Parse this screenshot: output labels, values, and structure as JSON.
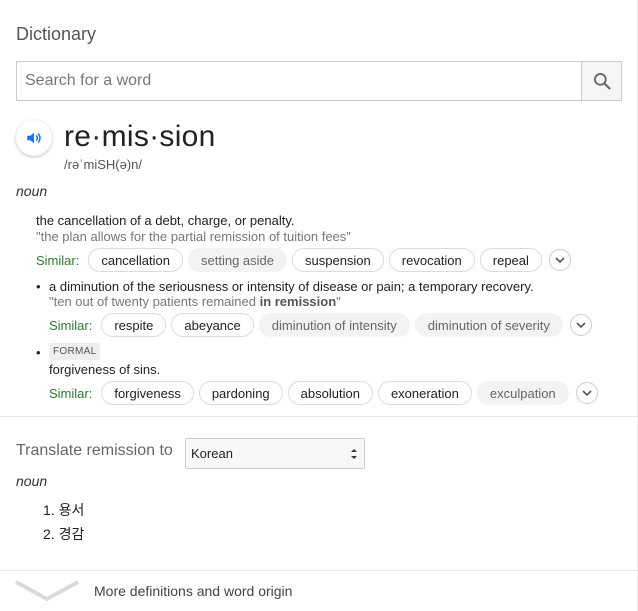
{
  "header": {
    "title": "Dictionary"
  },
  "search": {
    "placeholder": "Search for a word"
  },
  "entry": {
    "word": "re·mis·sion",
    "phonetic": "/rəˈmiSH(ə)n/",
    "part_of_speech": "noun",
    "senses": [
      {
        "definition": "the cancellation of a debt, charge, or penalty.",
        "example": "\"the plan allows for the partial remission of tuition fees\"",
        "similar_label": "Similar:",
        "similar": [
          "cancellation",
          "setting aside",
          "suspension",
          "revocation",
          "repeal"
        ],
        "similar_grey": [
          false,
          true,
          false,
          false,
          false
        ]
      },
      {
        "definition": "a diminution of the seriousness or intensity of disease or pain; a temporary recovery.",
        "example_pre": "\"ten out of twenty patients remained ",
        "example_bold": "in remission",
        "example_post": "\"",
        "similar_label": "Similar:",
        "similar": [
          "respite",
          "abeyance",
          "diminution of intensity",
          "diminution of severity"
        ],
        "similar_grey": [
          false,
          false,
          true,
          true
        ]
      },
      {
        "tag": "FORMAL",
        "definition": "forgiveness of sins.",
        "similar_label": "Similar:",
        "similar": [
          "forgiveness",
          "pardoning",
          "absolution",
          "exoneration",
          "exculpation"
        ],
        "similar_grey": [
          false,
          false,
          false,
          false,
          true
        ]
      }
    ]
  },
  "translate": {
    "label": "Translate remission to",
    "language": "Korean",
    "part_of_speech": "noun",
    "items": [
      "1. 용서",
      "2. 경감"
    ]
  },
  "footer": {
    "more_label": "More definitions and word origin"
  },
  "colors": {
    "accent_blue": "#1a73e8",
    "similar_green": "#2e7d32"
  },
  "icons": [
    "search-icon",
    "speaker-icon",
    "chevron-down-icon"
  ]
}
